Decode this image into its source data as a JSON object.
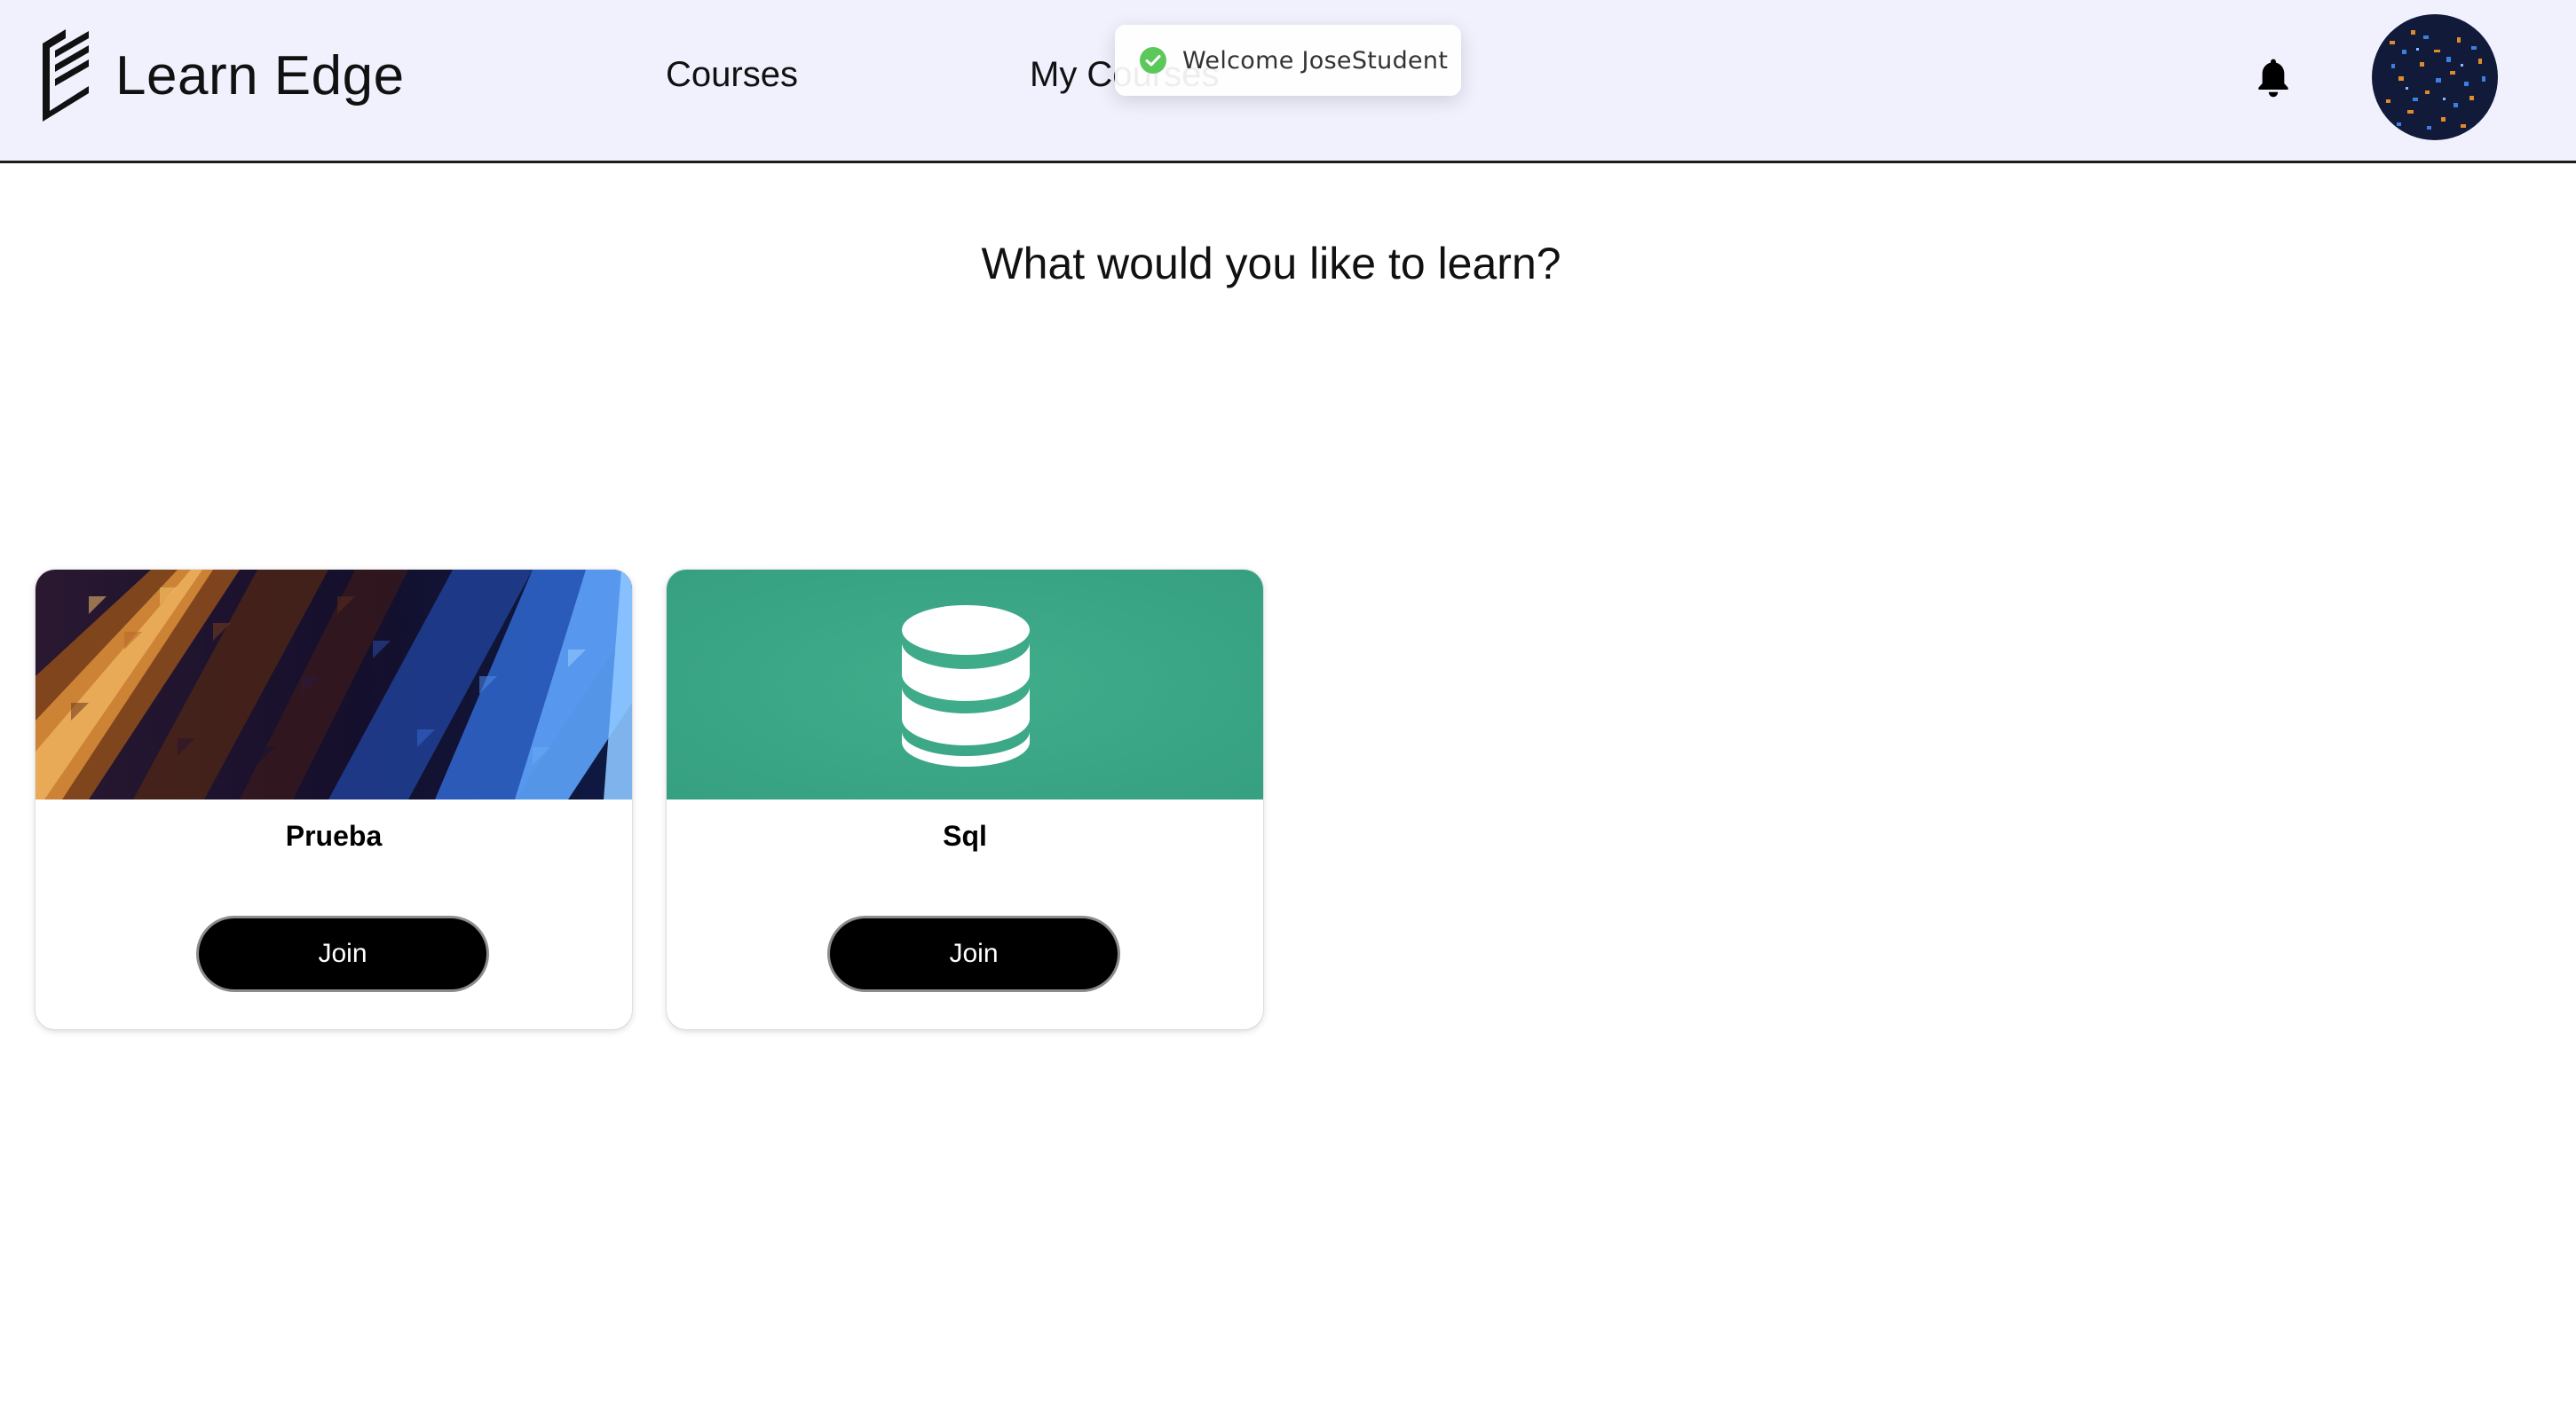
{
  "header": {
    "brand_name": "Learn Edge",
    "brand_logo_icon": "learn-edge-logo-icon",
    "nav": [
      {
        "label": "Courses"
      },
      {
        "label": "My Courses"
      }
    ],
    "notification_icon": "bell-icon",
    "avatar_icon": "user-avatar-image"
  },
  "toast": {
    "message": "Welcome JoseStudent",
    "icon": "check-circle-icon",
    "status_color": "#5cc85c"
  },
  "main": {
    "heading": "What would you like to learn?"
  },
  "courses": [
    {
      "title": "Prueba",
      "button_label": "Join",
      "image": "abstract-mosaic-image"
    },
    {
      "title": "Sql",
      "button_label": "Join",
      "image": "database-icon-banner",
      "banner_color": "#3aa987"
    }
  ],
  "colors": {
    "navbar_bg": "#f0f1fd",
    "button_bg": "#000000",
    "button_text": "#ffffff"
  }
}
